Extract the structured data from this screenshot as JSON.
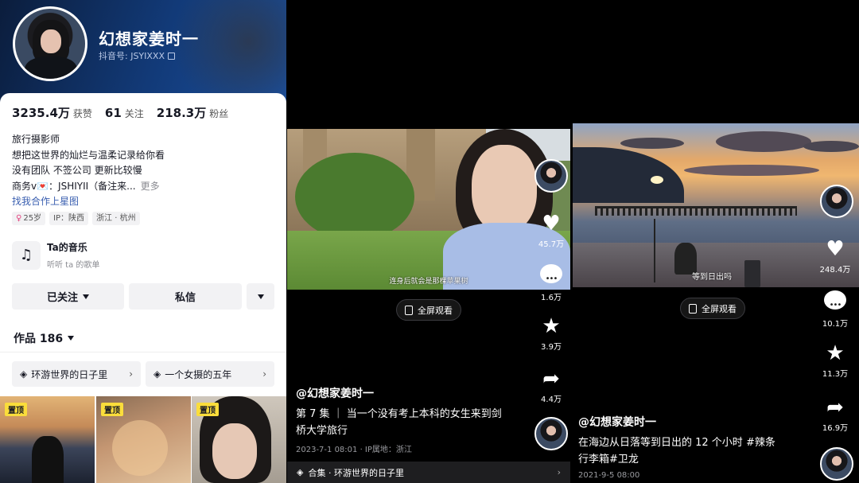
{
  "profile": {
    "name": "幻想家姜时一",
    "douyin_id": "抖音号: JSYIXXX",
    "stats": [
      {
        "value": "3235.4万",
        "label": "获赞"
      },
      {
        "value": "61",
        "label": "关注"
      },
      {
        "value": "218.3万",
        "label": "粉丝"
      }
    ],
    "bio": [
      "旅行摄影师",
      "想把这世界的灿烂与温柔记录给你看",
      "没有团队 不签公司 更新比较慢",
      "商务v💌：JSHIYII（备注来..."
    ],
    "bio_more": "更多",
    "link": "找我合作上星图",
    "tags": [
      {
        "symbol": "♀",
        "text": "25岁"
      },
      {
        "text": "IP：陕西"
      },
      {
        "text": "浙江 · 杭州"
      }
    ],
    "music": {
      "title": "Ta的音乐",
      "subtitle": "听听 ta 的歌单"
    },
    "buttons": {
      "follow": "已关注",
      "message": "私信"
    },
    "works": "作品 186",
    "collections": [
      "环游世界的日子里",
      "一个女摄的五年"
    ],
    "pin_label": "置顶"
  },
  "video1": {
    "subtitle": "连身后就会是那棵苹果树",
    "fullscreen": "全屏观看",
    "likes": "45.7万",
    "comments": "1.6万",
    "favorites": "3.9万",
    "shares": "4.4万",
    "author": "@幻想家姜时一",
    "desc_line1": "第 7 集 ｜ 当一个没有考上本科的女生来到剑",
    "desc_line2": "桥大学旅行",
    "meta": "2023-7-1 08:01 · IP属地：浙江",
    "collection_bar": "合集 · 环游世界的日子里"
  },
  "video2": {
    "subtitle": "等到日出吗",
    "fullscreen": "全屏观看",
    "likes": "248.4万",
    "comments": "10.1万",
    "favorites": "11.3万",
    "shares": "16.9万",
    "author": "@幻想家姜时一",
    "desc_line1": "在海边从日落等到日出的 12 个小时 #辣条",
    "desc_line2": "行李箱#卫龙",
    "meta": "2021-9-5 08:00"
  }
}
